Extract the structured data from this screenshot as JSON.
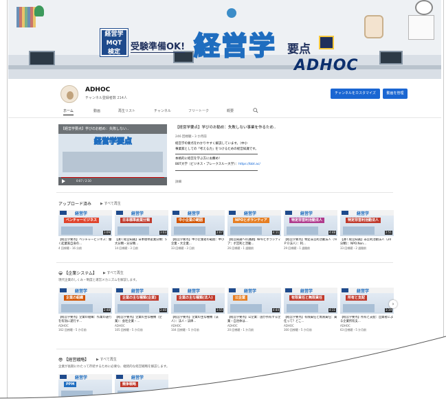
{
  "banner": {
    "badge_lines": [
      "経営学",
      "MQT",
      "検定"
    ],
    "subtitle": "受験準備OK!",
    "title": "経営学",
    "title_suffix": "要点",
    "brand": "ADHOC"
  },
  "channel": {
    "name": "ADHOC",
    "subscribers": "チャンネル登録者数 214人",
    "customize_label": "チャンネルをカスタマイズ",
    "manage_label": "動画を管理"
  },
  "tabs": [
    "ホーム",
    "動画",
    "再生リスト",
    "チャンネル",
    "フリートーク",
    "概要"
  ],
  "featured": {
    "player_title": "【経営学要点】学びのお勧め：失敗しない..",
    "thumb_text": "経営学要点",
    "time": "0:07 / 2:10",
    "title": "【経営学要点】学びのお勧め：失敗しない事業を作るため..",
    "meta": "246 回視聴・3 か月前",
    "desc_1": "経営学の要点をわかりやすく解説しています。（中小",
    "desc_2": "事業家としての「考える力」をつけるための経営知識です。",
    "desc_3": "本格的に経営を学ぶ方にお薦め！",
    "desc_4": "BBT大学（ビジネス・ブレークスルー大学）：",
    "desc_link": "https://bbt.ac/",
    "more": "詳細"
  },
  "sections": [
    {
      "title": "アップロード済み",
      "play_all": "すべて再生",
      "desc": "",
      "cards": [
        {
          "label": "ベンチャービジネス",
          "label_color": "#e0442c",
          "duration": "3:09",
          "title": "【経営学要点】ベンチャービジネス：働く起業家自身の...",
          "channel": "",
          "meta": "4 回視聴・16 分前"
        },
        {
          "label": "日本標準産業分類",
          "label_color": "#c0392b",
          "duration": "3:03",
          "title": "【課く経営知識】日本標準産業分類：5大分類・分分類...",
          "channel": "",
          "meta": "14 回視聴・3 日前"
        },
        {
          "label": "中小企業の範囲",
          "label_color": "#d35400",
          "duration": "2:07",
          "title": "【経営学要点】中小企業者の範囲：中小企業・大企業...",
          "channel": "",
          "meta": "33 回視聴・3 日前"
        },
        {
          "label": "NPOとボランティア",
          "label_color": "#e67e22",
          "duration": "4:11",
          "title": "【経営知識への課題】NPOとボランティア：ボ営利と活動...",
          "channel": "",
          "meta": "26 回視聴・1 週間前"
        },
        {
          "label": "特定非営利活動法人",
          "label_color": "#b03a8c",
          "duration": "4:48",
          "title": "【経営学要点】特定非営利活動法人（ＮＰＯ法人）：利...",
          "channel": "",
          "meta": "29 回視聴・1 週間前"
        },
        {
          "label": "特定非営利活動法人",
          "label_color": "#c0392b",
          "duration": "2:51",
          "title": "【課く経営知識】非営利活動法人（20分類）：NPO.Non...",
          "channel": "",
          "meta": "33 回視聴・2 週間前"
        }
      ]
    },
    {
      "title": "【企業システム】",
      "play_all": "すべて再生",
      "desc": "現代企業のしくみ・制度と運営メカニズムを解説します。",
      "cards": [
        {
          "label": "企業の組織",
          "label_color": "#d35400",
          "duration": "2:48",
          "title": "【経営学要点】企業の組織：作業の遂行を有効に遂行す...",
          "channel": "ADHOC",
          "meta": "162 回視聴・5 か月前"
        },
        {
          "label": "企業の主な種類(企業)",
          "label_color": "#c0392b",
          "duration": "2:40",
          "title": "【経営学要点】企業の主な種類（企業）：会社企業・...",
          "channel": "ADHOC",
          "meta": "105 回視聴・5 か月前"
        },
        {
          "label": "企業の主な種類(法人)",
          "label_color": "#c0392b",
          "duration": "3:55",
          "title": "【経営学要点】企業の主な種類（法人）：法人・法律...",
          "channel": "ADHOC",
          "meta": "104 回視聴・5 か月前"
        },
        {
          "label": "公企業",
          "label_color": "#e67e22",
          "duration": "4:44",
          "title": "【経営学要点】公企業：国が所有する企業・自治体は...",
          "channel": "ADHOC",
          "meta": "20 回視聴・1 か月前"
        },
        {
          "label": "有限責任と無限責任",
          "label_color": "#c0392b",
          "duration": "4:11",
          "title": "【経営学要点】有限責任と無限責任：責任って？どこ...",
          "channel": "ADHOC",
          "meta": "300 回視聴・5 か月前"
        },
        {
          "label": "所有と支配",
          "label_color": "#c0392b",
          "duration": "3:19",
          "title": "【経営学要点】所有と支配：出資者による企業所有支...",
          "channel": "ADHOC",
          "meta": "63 回視聴・5 か月前"
        }
      ]
    },
    {
      "title": "【経営戦略】",
      "play_all": "すべて再生",
      "desc": "企業が長期にわたって存続するために必要な、継続的な経営戦略を解説します。",
      "cards": [
        {
          "label": "PPM",
          "label_color": "#1f6dbf",
          "duration": "",
          "title": "",
          "channel": "",
          "meta": ""
        },
        {
          "label": "競争戦略",
          "label_color": "#c0392b",
          "duration": "",
          "title": "",
          "channel": "",
          "meta": ""
        }
      ]
    }
  ],
  "next_arrow": "›"
}
